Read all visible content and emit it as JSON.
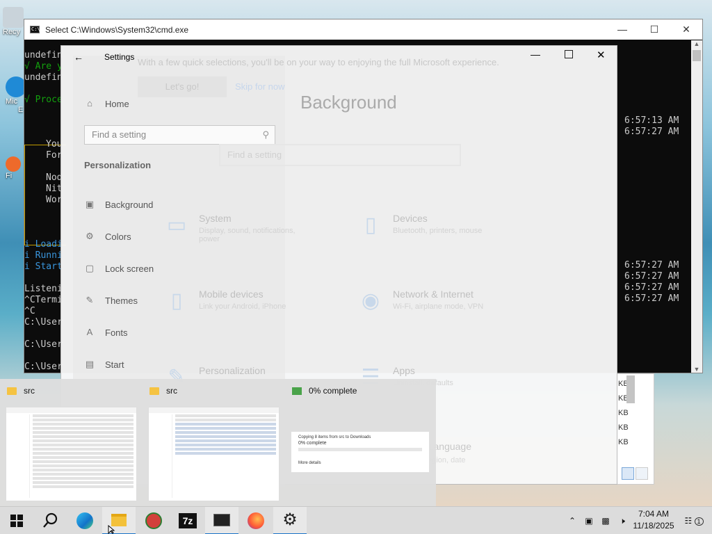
{
  "cmd": {
    "title": "Select C:\\Windows\\System32\\cmd.exe",
    "lines_left": [
      "undefin",
      "√ Are y",
      "undefin",
      "√ Proce",
      "You",
      "For",
      "Nod",
      "Nit",
      "Wor",
      "i Loadi",
      "i Runni",
      "i Start",
      "Listeni",
      "^CTermi",
      "^C",
      "C:\\User",
      "C:\\User",
      "C:\\User"
    ],
    "timestamps": [
      "6:57:13 AM",
      "6:57:27 AM",
      "6:57:27 AM",
      "6:57:27 AM",
      "6:57:27 AM",
      "6:57:27 AM"
    ]
  },
  "settings": {
    "title": "Settings",
    "back_icon": "arrow-left-icon",
    "nav": {
      "home": "Home",
      "search_placeholder": "Find a setting",
      "section": "Personalization",
      "items": [
        {
          "label": "Background",
          "icon": "picture-icon"
        },
        {
          "label": "Colors",
          "icon": "palette-icon"
        },
        {
          "label": "Lock screen",
          "icon": "lock-screen-icon"
        },
        {
          "label": "Themes",
          "icon": "brush-icon"
        },
        {
          "label": "Fonts",
          "icon": "font-icon"
        },
        {
          "label": "Start",
          "icon": "start-icon"
        }
      ]
    },
    "page_title": "Background",
    "bg_welcome": "With a few quick selections, you'll be on your way to enjoying the full Microsoft experience.",
    "bg_lets_go": "Let's go!",
    "bg_skip": "Skip for now",
    "bg_search_placeholder": "Find a setting",
    "categories": [
      {
        "name": "System",
        "desc": "Display, sound, notifications, power"
      },
      {
        "name": "Devices",
        "desc": "Bluetooth, printers, mouse"
      },
      {
        "name": "Mobile devices",
        "desc": "Link your Android, iPhone"
      },
      {
        "name": "Network & Internet",
        "desc": "Wi-Fi, airplane mode, VPN"
      },
      {
        "name": "Personalization",
        "desc": ""
      },
      {
        "name": "Apps",
        "desc": "Uninstall, defaults"
      }
    ],
    "faded_language": "Time & Language",
    "faded_lang_desc": "Speech, region, date"
  },
  "thumbnails": [
    {
      "title": "src"
    },
    {
      "title": "src"
    },
    {
      "title": "0% complete",
      "copy_text": "Copying 8 items from src to Downloads",
      "copy_pct": "0% complete",
      "more_details": "More details"
    }
  ],
  "explorer_peek": {
    "sizes": [
      "KB",
      "KB",
      "KB",
      "KB",
      "KB"
    ]
  },
  "taskbar": {
    "apps": [
      "start-icon",
      "search-icon",
      "edge-icon",
      "file-explorer-icon",
      "app-icon",
      "7zip-icon",
      "terminal-icon",
      "firefox-icon",
      "settings-icon"
    ],
    "sevenzip_label": "7z",
    "clock_time": "7:04 AM",
    "clock_date": "11/18/2025",
    "notification_count": "1"
  },
  "desktop_icons": [
    {
      "label": "Recy"
    },
    {
      "label": "Mic"
    },
    {
      "label": "E"
    },
    {
      "label": "Fi"
    }
  ]
}
